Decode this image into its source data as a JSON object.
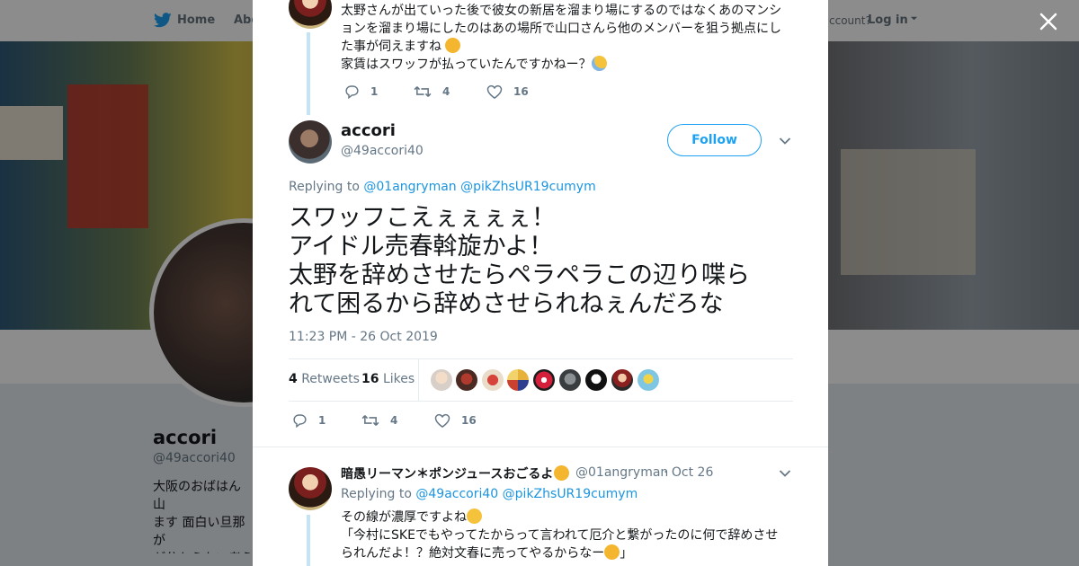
{
  "nav": {
    "home": "Home",
    "about": "Abo",
    "account_prompt": "ccount?",
    "login": "Log in"
  },
  "profile": {
    "name": "accori",
    "handle": "@49accori40",
    "bio": "大阪のおばはん 山\nます 面白い旦那が\nが分からない考え\nも心もブサイクな"
  },
  "prev_tweet": {
    "text_line1": "太野さんが出ていった後で彼女の新居を溜まり場にするのではなくあのマンシ",
    "text_line2": "ョンを溜まり場にしたのはあの場所で山口さんら他のメンバーを狙う拠点にし",
    "text_line3": "た事が伺えますね",
    "text_line4": "家賃はスワッフが払っていたんですかねー？",
    "reply_count": "1",
    "retweet_count": "4",
    "like_count": "16"
  },
  "main_tweet": {
    "name": "accori",
    "handle": "@49accori40",
    "follow_label": "Follow",
    "replying_label": "Replying to",
    "replying_to_1": "@01angryman",
    "replying_to_2": "@pikZhsUR19cumym",
    "text": "スワッフこえぇぇぇぇ！\nアイドル売春斡旋かよ！\n太野を辞めさせたらペラペラこの辺り喋ら\nれて困るから辞めさせられねぇんだろな",
    "timestamp": "11:23 PM - 26 Oct 2019",
    "retweets_num": "4",
    "retweets_label": "Retweets",
    "likes_num": "16",
    "likes_label": "Likes",
    "reply_count": "1",
    "retweet_count": "4",
    "like_count": "16"
  },
  "reply_tweet": {
    "name": "暗愚リーマン＊ポンジュースおごるよ",
    "handle": "@01angryman",
    "date": "· Oct 26",
    "replying_label": "Replying to",
    "replying_to_1": "@49accori40",
    "replying_to_2": "@pikZhsUR19cumym",
    "text_line1": "その線が濃厚ですよね",
    "text_line2": "「今村にSKEでもやってたからって言われて厄介と繋がったのに何で辞めさせ",
    "text_line3": "られんだよ！？絶対文春に売ってやるからなー",
    "text_line3_end": "」"
  },
  "colors": {
    "accent": "#1da1f2",
    "link": "#1b95e0",
    "muted": "#657786",
    "thread_line": "#c4e4f5"
  },
  "icons": {
    "close": "close-icon",
    "reply": "reply-icon",
    "retweet": "retweet-icon",
    "like": "heart-icon",
    "chevron": "chevron-down-icon",
    "bird": "twitter-bird-icon"
  }
}
